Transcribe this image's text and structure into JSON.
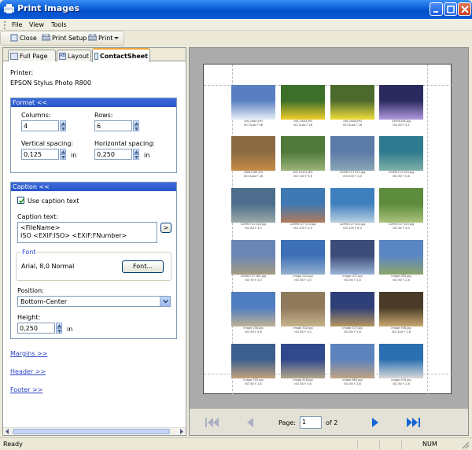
{
  "window": {
    "title": "Print Images"
  },
  "menu": [
    "File",
    "View",
    "Tools"
  ],
  "toolbar": {
    "close": "Close",
    "print_setup": "Print Setup",
    "print": "Print"
  },
  "tabs": [
    "Full Page",
    "Layout",
    "ContactSheet"
  ],
  "printer": {
    "label": "Printer:",
    "name": "EPSON Stylus Photo R800"
  },
  "format": {
    "header": "Format <<",
    "columns_label": "Columns:",
    "columns": "4",
    "rows_label": "Rows:",
    "rows": "6",
    "vspacing_label": "Vertical spacing:",
    "vspacing": "0,125",
    "vspacing_unit": "in",
    "hspacing_label": "Horizontal spacing:",
    "hspacing": "0,250",
    "hspacing_unit": "in"
  },
  "caption": {
    "header": "Caption <<",
    "use_caption": "Use caption text",
    "text_label": "Caption text:",
    "text_line1": "<FileName>",
    "text_line2": "ISO <EXIF:ISO> <EXIF:FNumber>",
    "insert_button": ">",
    "font_legend": "Font",
    "font_value": "Arial, 8,0 Normal",
    "font_button": "Font...",
    "position_label": "Position:",
    "position_value": "Bottom-Center",
    "height_label": "Height:",
    "height_value": "0,250",
    "height_unit": "in"
  },
  "links": [
    "Margins >>",
    "Header >>",
    "Footer >>"
  ],
  "thumbnails": [
    {
      "name": "106_0887.JPG",
      "meta": "ISO Auto F 98"
    },
    {
      "name": "106_0843.JPG",
      "meta": "ISO Auto F 28"
    },
    {
      "name": "106_0840.JPG",
      "meta": "ISO Auto F 28"
    },
    {
      "name": "03990108.jpg",
      "meta": "ISO 80 F 4,5"
    },
    {
      "name": "03661465.JPG",
      "meta": "ISO Auto F 28"
    },
    {
      "name": "DSCF0415.JPG",
      "meta": "ISO 100 F 6,6"
    },
    {
      "name": "CD990713 011.jpg",
      "meta": "ISO 400 F 4,0"
    },
    {
      "name": "CD990724 029.jpg",
      "meta": "ISO 80 F 5,6"
    },
    {
      "name": "CD990724 026.jpg",
      "meta": "ISO 80 F 4,0"
    },
    {
      "name": "CD990727 014.jpg",
      "meta": "ISO 200 F 4,0"
    },
    {
      "name": "CD990727 004.jpg",
      "meta": "ISO 200 F 8,0"
    },
    {
      "name": "CD990727 049.jpg",
      "meta": "ISO 80 F 4,0"
    },
    {
      "name": "CD990727 081.jpg",
      "meta": "ISO 50 F 4,0"
    },
    {
      "name": "image 022.jpg",
      "meta": "ISO 80 F 4,0"
    },
    {
      "name": "image 037.jpg",
      "meta": "ISO 80 F 2,8"
    },
    {
      "name": "image 063.jpg",
      "meta": "ISO 80 F 2,8"
    },
    {
      "name": "image 208.jpg",
      "meta": "ISO 80 F 5,6"
    },
    {
      "name": "image 302.jpg",
      "meta": "ISO 80 F 4,0"
    },
    {
      "name": "image 327.jpg",
      "meta": "ISO 80 F 2,8"
    },
    {
      "name": "image 358.jpg",
      "meta": "ISO 400 F 2,8"
    },
    {
      "name": "image 703.jpg",
      "meta": "ISO 80 F 2,8"
    },
    {
      "name": "image 818.jpg",
      "meta": "ISO 80 F 5,6"
    },
    {
      "name": "image 862.jpg",
      "meta": "ISO 80 F 2,8"
    },
    {
      "name": "image 878.jpg",
      "meta": "ISO 80 F 2,8"
    }
  ],
  "pager": {
    "label": "Page:",
    "current": "1",
    "total": "of 2"
  },
  "status": {
    "text": "Ready",
    "num": "NUM"
  },
  "colors": {
    "accent": "#2855c7",
    "link": "#2a43c8",
    "nav_active": "#1565d8"
  }
}
